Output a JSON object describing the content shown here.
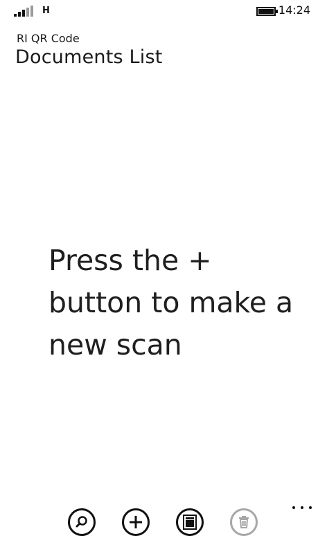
{
  "status_bar": {
    "network": "H",
    "time": "14:24"
  },
  "header": {
    "app_name": "RI QR Code",
    "page_title": "Documents List"
  },
  "empty_state": {
    "message": "Press the + button to make a new scan"
  },
  "app_bar": {
    "buttons": [
      {
        "icon": "search-icon",
        "enabled": true
      },
      {
        "icon": "add-icon",
        "enabled": true
      },
      {
        "icon": "document-icon",
        "enabled": true
      },
      {
        "icon": "trash-icon",
        "enabled": false
      }
    ],
    "more_icon": "more-options-icon"
  }
}
